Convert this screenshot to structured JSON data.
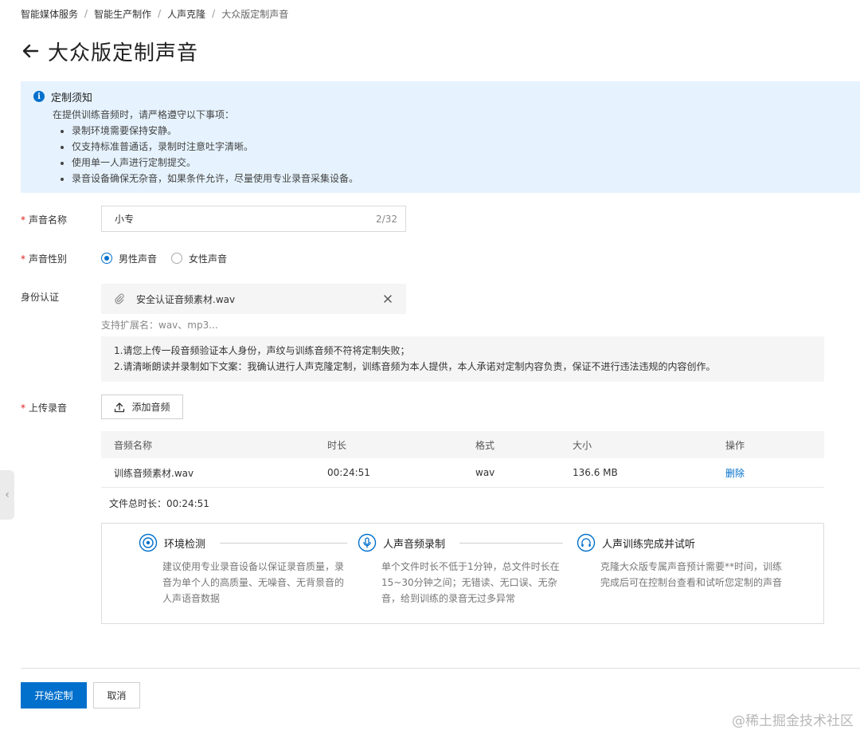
{
  "breadcrumb": {
    "items": [
      "智能媒体服务",
      "智能生产制作",
      "人声克隆",
      "大众版定制声音"
    ],
    "separator": "/"
  },
  "header": {
    "title": "大众版定制声音"
  },
  "notice": {
    "title": "定制须知",
    "intro": "在提供训练音频时，请严格遵守以下事项：",
    "items": [
      "录制环境需要保持安静。",
      "仅支持标准普通话，录制时注意吐字清晰。",
      "使用单一人声进行定制提交。",
      "录音设备确保无杂音，如果条件允许，尽量使用专业录音采集设备。"
    ]
  },
  "form": {
    "required_mark": "*",
    "name_label": "声音名称",
    "name_value": "小专",
    "name_count": "2/32",
    "gender_label": "声音性别",
    "gender_options": [
      "男性声音",
      "女性声音"
    ],
    "gender_selected": "男性声音",
    "identity_label": "身份认证",
    "identity_file": "安全认证音频素材.wav",
    "ext_hint": "支持扩展名：wav、mp3...",
    "instructions": [
      "1.请您上传一段音频验证本人身份，声纹与训练音频不符将定制失败；",
      "2.请清晰朗读并录制如下文案：我确认进行人声克隆定制，训练音频为本人提供，本人承诺对定制内容负责，保证不进行违法违规的内容创作。"
    ],
    "upload_label": "上传录音",
    "add_audio_label": "添加音频"
  },
  "audio_table": {
    "headers": [
      "音频名称",
      "时长",
      "格式",
      "大小",
      "操作"
    ],
    "rows": [
      {
        "name": "训练音频素材.wav",
        "duration": "00:24:51",
        "format": "wav",
        "size": "136.6 MB",
        "action": "删除"
      }
    ]
  },
  "total_duration": "文件总时长：00:24:51",
  "steps": [
    {
      "icon": "target-icon",
      "title": "环境检测",
      "desc": [
        "建议使用专业录音设备以保证录音质量，录",
        "音为单个人的高质量、无噪音、无背景音的",
        "人声语音数据"
      ]
    },
    {
      "icon": "microphone-icon",
      "title": "人声音频录制",
      "desc": [
        "单个文件时长不低于1分钟，总文件时长在",
        "15~30分钟之间；无错读、无口误、无杂",
        "音，给到训练的录音无过多异常"
      ]
    },
    {
      "icon": "headphones-icon",
      "title": "人声训练完成并试听",
      "desc": [
        "克隆大众版专属声音预计需要**时间，训练",
        "完成后可在控制台查看和试听您定制的声音"
      ]
    }
  ],
  "buttons": {
    "submit": "开始定制",
    "cancel": "取消"
  },
  "side_handle": "‹",
  "watermark": "@稀土掘金技术社区",
  "colors": {
    "accent": "#0070cc",
    "notice_bg": "#e6f3fe",
    "required": "#e02020"
  }
}
